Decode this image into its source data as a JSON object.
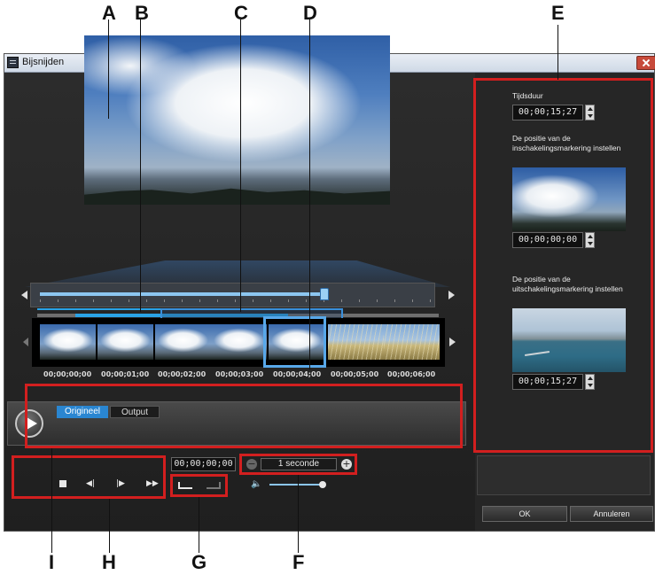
{
  "window": {
    "title": "Bijsnijden"
  },
  "callouts": {
    "A": "A",
    "B": "B",
    "C": "C",
    "D": "D",
    "E": "E",
    "F": "F",
    "G": "G",
    "H": "H",
    "I": "I"
  },
  "filmstrip": {
    "timecodes": [
      "00;00;00;00",
      "00;00;01;00",
      "00;00;02;00",
      "00;00;03;00",
      "00;00;04;00",
      "00;00;05;00",
      "00;00;06;00"
    ]
  },
  "controls": {
    "mode_original": "Origineel",
    "mode_output": "Output",
    "current_time": "00;00;00;00",
    "zoom_label": "1 seconde"
  },
  "panel": {
    "duration_label": "Tijdsduur",
    "duration_value": "00;00;15;27",
    "in_label": "De positie van de inschakelingsmarkering instellen",
    "in_value": "00;00;00;00",
    "out_label": "De positie van de uitschakelingsmarkering instellen",
    "out_value": "00;00;15;27"
  },
  "buttons": {
    "ok": "OK",
    "cancel": "Annuleren"
  },
  "colors": {
    "annotation_red": "#d21f1f",
    "accent_blue": "#2aa3e6"
  }
}
